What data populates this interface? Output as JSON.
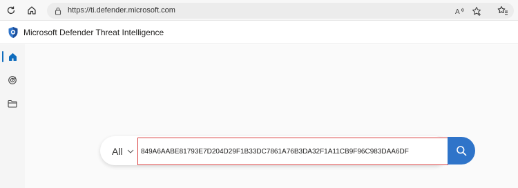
{
  "browser": {
    "url": "https://ti.defender.microsoft.com"
  },
  "app": {
    "title": "Microsoft Defender Threat Intelligence"
  },
  "sidebar": {
    "items": [
      {
        "name": "home",
        "active": true
      },
      {
        "name": "intel-profiles",
        "active": false
      },
      {
        "name": "projects",
        "active": false
      }
    ]
  },
  "search": {
    "scope_label": "All",
    "query": "849A6AABE81793E7D204D29F1B33DC7861A76B3DA32F1A11CB9F96C983DAA6DF"
  },
  "colors": {
    "accent": "#2f74c9",
    "input_border": "#d83b3b",
    "active_indicator": "#0f6cbd"
  }
}
